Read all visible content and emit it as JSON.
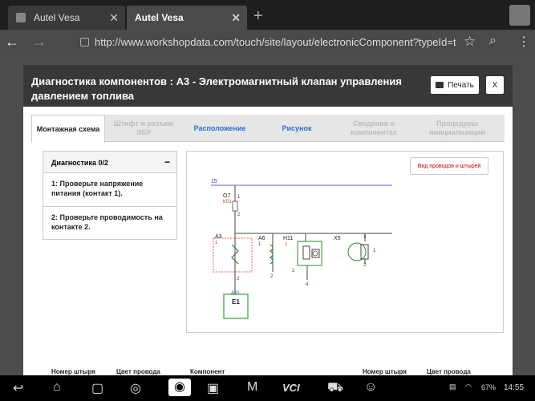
{
  "browser": {
    "tabs": [
      {
        "label": "Autel Vesa"
      },
      {
        "label": "Autel Vesa"
      }
    ],
    "url": "http://www.workshopdata.com/touch/site/layout/electronicComponent?typeId=t"
  },
  "modal": {
    "title": "Диагностика компонентов : A3 - Электромагнитный клапан управления давлением топлива",
    "print_label": "Печать",
    "close_label": "X",
    "tabs": [
      {
        "label": "Монтажная схема"
      },
      {
        "label": "Штифт и разъем ЭБУ"
      },
      {
        "label": "Расположение"
      },
      {
        "label": "Рисунок"
      },
      {
        "label": "Сведения о компонентах"
      },
      {
        "label": "Процедуры инициализации"
      }
    ],
    "diagnosis": {
      "title": "Диагностика 0/2",
      "collapse_symbol": "−",
      "steps": [
        {
          "label": "1: Проверьте напряжение питания (контакт 1)."
        },
        {
          "label": "2: Проверьте проводимость на контакте 2."
        }
      ]
    },
    "schematic": {
      "wires_button": "Вид проводов и штырей",
      "labels": {
        "line": "15",
        "fuse_name": "O7",
        "fuse_sub": "K01",
        "a3": "A3",
        "a6": "A6",
        "h11": "H11",
        "x5": "X5",
        "ecu_top": "A51",
        "ecu": "E1",
        "p1": "1",
        "p2": "2",
        "p3": "3",
        "p4": "4"
      }
    },
    "table_headers": [
      "Номер штыря",
      "Цвет провода",
      "Компонент",
      "Номер штыря",
      "Цвет провода"
    ]
  },
  "system": {
    "battery": "67%",
    "time": "14:55"
  }
}
